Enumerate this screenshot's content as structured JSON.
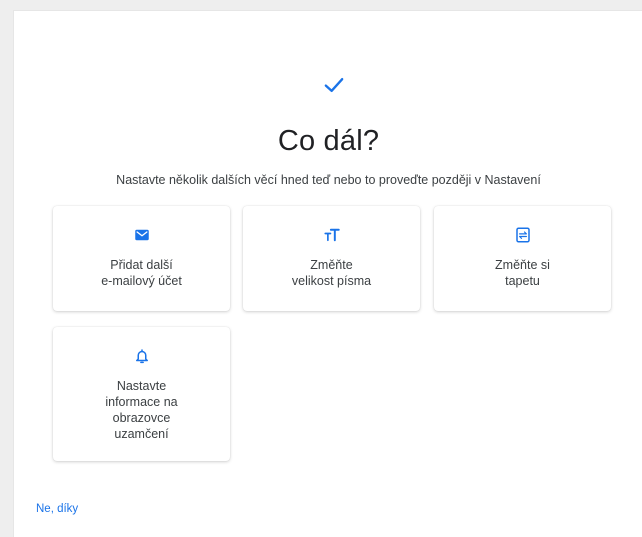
{
  "header": {
    "title": "Co dál?",
    "subtitle": "Nastavte několik dalších věcí hned teď nebo to proveďte později v Nastavení",
    "icon": "check-icon"
  },
  "cards": [
    {
      "id": "add-email",
      "label": "Přidat další\ne-mailový účet",
      "icon": "mail-icon"
    },
    {
      "id": "font-size",
      "label": "Změňte\nvelikost písma",
      "icon": "text-size-icon"
    },
    {
      "id": "wallpaper",
      "label": "Změňte si\ntapetu",
      "icon": "wallpaper-icon"
    },
    {
      "id": "lock-screen",
      "label": "Nastavte\ninformace na\nobrazovce\nuzamčení",
      "icon": "bell-icon"
    }
  ],
  "footer": {
    "no_thanks": "Ne, díky"
  },
  "colors": {
    "accent": "#1a73e8",
    "text": "#202124",
    "secondary_text": "#3c4043",
    "background": "#eeeeee",
    "card": "#ffffff"
  }
}
